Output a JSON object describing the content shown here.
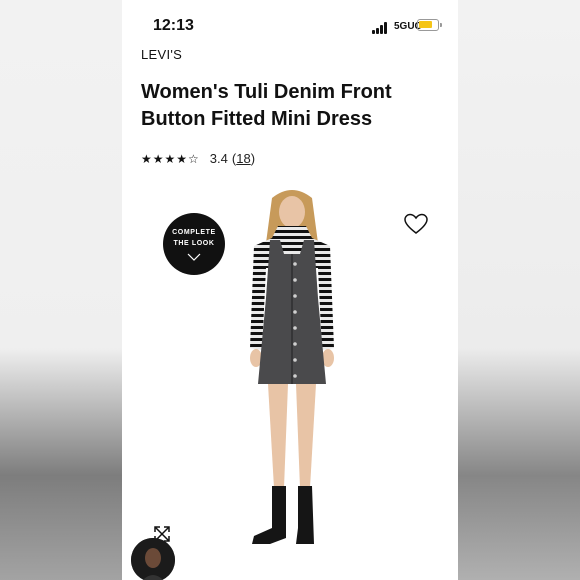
{
  "status_bar": {
    "time": "12:13",
    "network": "5GUC"
  },
  "product": {
    "brand": "LEVI'S",
    "title": "Women's Tuli Denim Front Button Fitted Mini Dress",
    "rating": {
      "stars": "★★★★☆",
      "score": "3.4",
      "count_prefix": "(",
      "count": "18",
      "count_suffix": ")",
      "value": 3.4
    }
  },
  "complete_the_look": {
    "line1": "COMPLETE",
    "line2": "THE LOOK"
  },
  "icons": {
    "favorite": "heart-icon",
    "expand": "expand-icon",
    "chevron": "chevron-down-icon"
  },
  "colors": {
    "battery": "#f5c518",
    "badge": "#111111"
  }
}
